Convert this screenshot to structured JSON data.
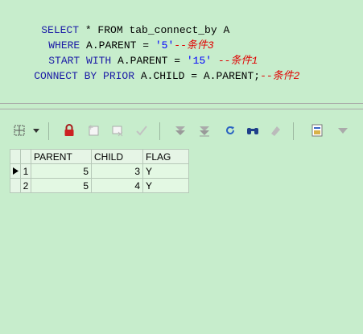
{
  "editor": {
    "line1": {
      "kw1": "SELECT",
      "rest": " * FROM tab_connect_by A"
    },
    "line2": {
      "kw": "WHERE",
      "expr": " A.PARENT = ",
      "val": "'5'",
      "comment": "--条件3"
    },
    "line3": {
      "kw": "START WITH",
      "expr": " A.PARENT = ",
      "val": "'15'",
      "comment": " --条件1"
    },
    "line4": {
      "kw": "CONNECT BY PRIOR",
      "expr": " A.CHILD = A.PARENT;",
      "comment": "--条件2"
    }
  },
  "toolbar": {
    "icons": [
      "grid-select-icon",
      "dropdown-arrow-icon",
      "lock-icon",
      "add-record-icon",
      "delete-record-icon",
      "post-check-icon",
      "first-down-icon",
      "last-down-icon",
      "refresh-icon",
      "find-icon",
      "clear-icon",
      "export-icon",
      "more-arrow-icon"
    ]
  },
  "grid": {
    "columns": [
      "PARENT",
      "CHILD",
      "FLAG"
    ],
    "rows": [
      {
        "num": "1",
        "parent": "5",
        "child": "3",
        "flag": "Y"
      },
      {
        "num": "2",
        "parent": "5",
        "child": "4",
        "flag": "Y"
      }
    ]
  },
  "colors": {
    "background": "#c7edcc",
    "keyword": "#1a1aa6",
    "comment": "#e00000"
  }
}
